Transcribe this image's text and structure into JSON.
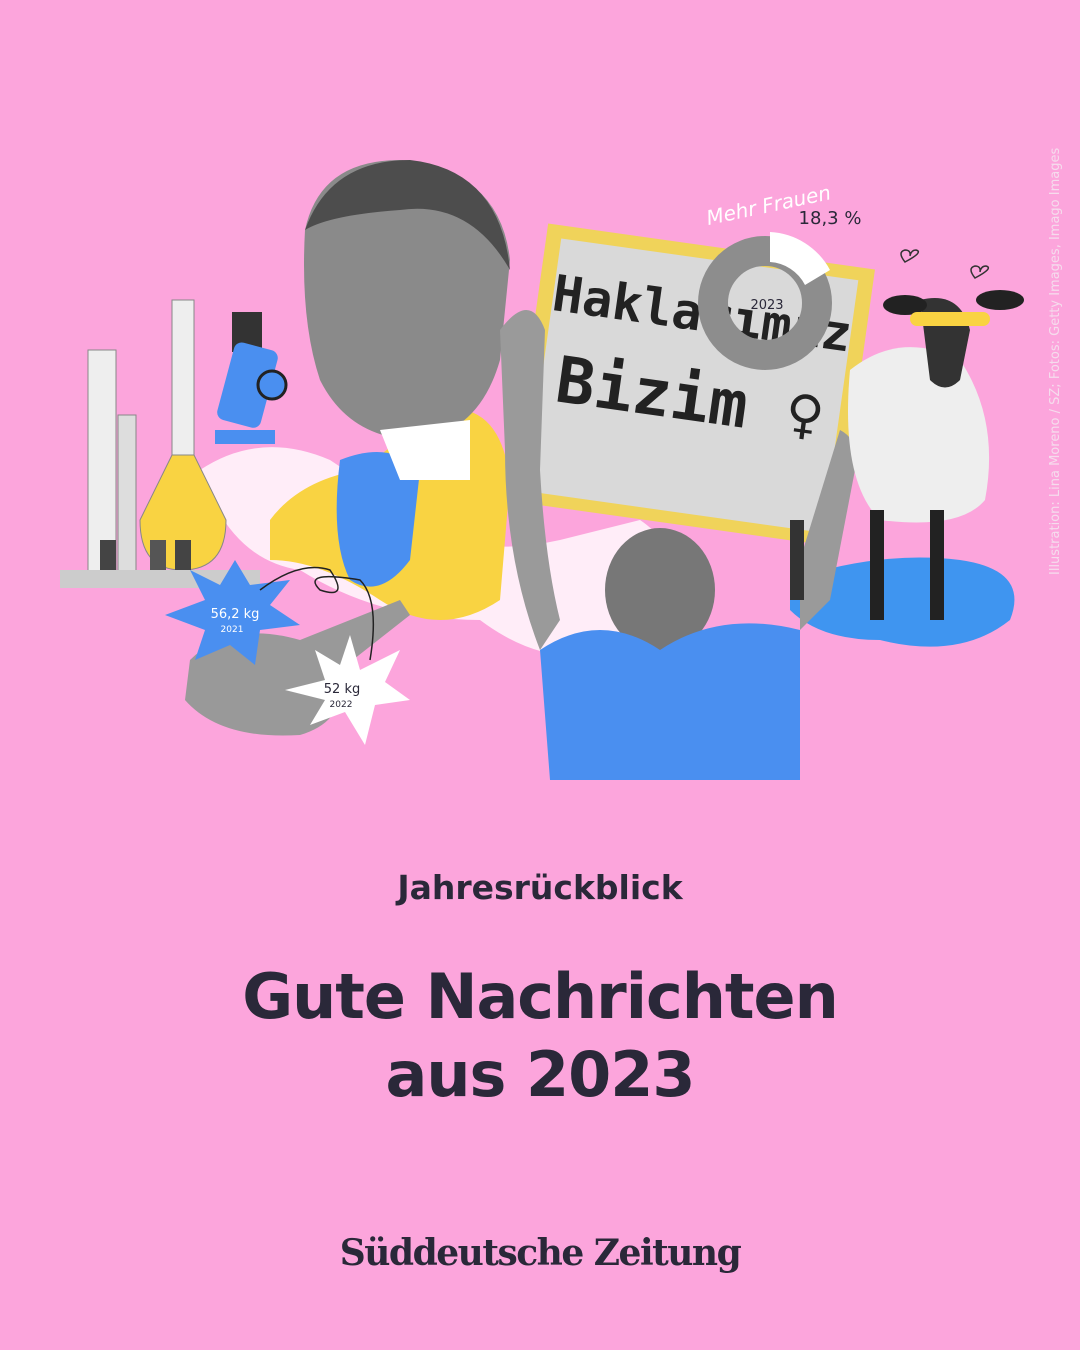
{
  "credit": "Illustration: Lina Moreno / SZ; Fotos: Getty Images, Imago Images",
  "collage": {
    "sign_text_line1": "Haklarımız",
    "sign_text_line2": "Bizim ♀",
    "donut": {
      "handwritten_label": "Mehr Frauen",
      "value_label": "18,3 %",
      "center_label": "2023",
      "share_percent": 18.3
    },
    "meat_stat_2021": {
      "value": "56,2 kg",
      "year": "2021"
    },
    "meat_stat_2022": {
      "value": "52 kg",
      "year": "2022"
    },
    "icons": [
      "lab-glassware-icon",
      "microscope-icon",
      "meat-icon",
      "sheep-icon",
      "heart-icon"
    ]
  },
  "kicker": "Jahresrückblick",
  "title_line1": "Gute Nachrichten",
  "title_line2": "aus 2023",
  "logo": "Süddeutsche Zeitung",
  "colors": {
    "background": "#fca5dc",
    "text": "#2a2839",
    "yellow": "#f9d342",
    "blue": "#4a8ff0"
  }
}
